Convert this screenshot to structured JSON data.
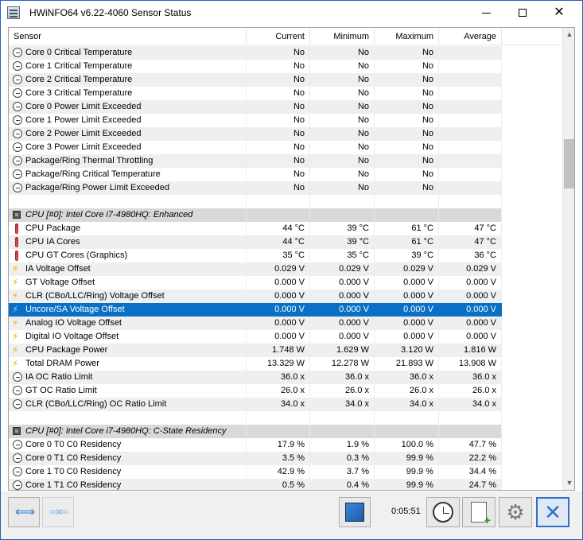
{
  "window": {
    "title": "HWiNFO64 v6.22-4060 Sensor Status"
  },
  "columns": [
    "Sensor",
    "Current",
    "Minimum",
    "Maximum",
    "Average"
  ],
  "rows": [
    {
      "kind": "clock",
      "alt": true,
      "name": "Core 0 Critical Temperature",
      "cur": "No",
      "min": "No",
      "max": "No",
      "avg": ""
    },
    {
      "kind": "clock",
      "alt": false,
      "name": "Core 1 Critical Temperature",
      "cur": "No",
      "min": "No",
      "max": "No",
      "avg": ""
    },
    {
      "kind": "clock",
      "alt": true,
      "name": "Core 2 Critical Temperature",
      "cur": "No",
      "min": "No",
      "max": "No",
      "avg": ""
    },
    {
      "kind": "clock",
      "alt": false,
      "name": "Core 3 Critical Temperature",
      "cur": "No",
      "min": "No",
      "max": "No",
      "avg": ""
    },
    {
      "kind": "clock",
      "alt": true,
      "name": "Core 0 Power Limit Exceeded",
      "cur": "No",
      "min": "No",
      "max": "No",
      "avg": ""
    },
    {
      "kind": "clock",
      "alt": false,
      "name": "Core 1 Power Limit Exceeded",
      "cur": "No",
      "min": "No",
      "max": "No",
      "avg": ""
    },
    {
      "kind": "clock",
      "alt": true,
      "name": "Core 2 Power Limit Exceeded",
      "cur": "No",
      "min": "No",
      "max": "No",
      "avg": ""
    },
    {
      "kind": "clock",
      "alt": false,
      "name": "Core 3 Power Limit Exceeded",
      "cur": "No",
      "min": "No",
      "max": "No",
      "avg": ""
    },
    {
      "kind": "clock",
      "alt": true,
      "name": "Package/Ring Thermal Throttling",
      "cur": "No",
      "min": "No",
      "max": "No",
      "avg": ""
    },
    {
      "kind": "clock",
      "alt": false,
      "name": "Package/Ring Critical Temperature",
      "cur": "No",
      "min": "No",
      "max": "No",
      "avg": ""
    },
    {
      "kind": "clock",
      "alt": true,
      "name": "Package/Ring Power Limit Exceeded",
      "cur": "No",
      "min": "No",
      "max": "No",
      "avg": ""
    },
    {
      "kind": "blank",
      "alt": false,
      "name": "",
      "cur": "",
      "min": "",
      "max": "",
      "avg": ""
    },
    {
      "kind": "group",
      "alt": false,
      "name": "CPU [#0]: Intel Core i7-4980HQ: Enhanced",
      "cur": "",
      "min": "",
      "max": "",
      "avg": ""
    },
    {
      "kind": "therm",
      "alt": false,
      "name": "CPU Package",
      "cur": "44 °C",
      "min": "39 °C",
      "max": "61 °C",
      "avg": "47 °C"
    },
    {
      "kind": "therm",
      "alt": true,
      "name": "CPU IA Cores",
      "cur": "44 °C",
      "min": "39 °C",
      "max": "61 °C",
      "avg": "47 °C"
    },
    {
      "kind": "therm",
      "alt": false,
      "name": "CPU GT Cores (Graphics)",
      "cur": "35 °C",
      "min": "35 °C",
      "max": "39 °C",
      "avg": "36 °C"
    },
    {
      "kind": "bolt",
      "alt": true,
      "name": "IA Voltage Offset",
      "cur": "0.029 V",
      "min": "0.029 V",
      "max": "0.029 V",
      "avg": "0.029 V"
    },
    {
      "kind": "bolt",
      "alt": false,
      "name": "GT Voltage Offset",
      "cur": "0.000 V",
      "min": "0.000 V",
      "max": "0.000 V",
      "avg": "0.000 V"
    },
    {
      "kind": "bolt",
      "alt": true,
      "name": "CLR (CBo/LLC/Ring) Voltage Offset",
      "cur": "0.000 V",
      "min": "0.000 V",
      "max": "0.000 V",
      "avg": "0.000 V"
    },
    {
      "kind": "bolt",
      "alt": false,
      "sel": true,
      "name": "Uncore/SA Voltage Offset",
      "cur": "0.000 V",
      "min": "0.000 V",
      "max": "0.000 V",
      "avg": "0.000 V"
    },
    {
      "kind": "bolt",
      "alt": true,
      "name": "Analog IO Voltage Offset",
      "cur": "0.000 V",
      "min": "0.000 V",
      "max": "0.000 V",
      "avg": "0.000 V"
    },
    {
      "kind": "bolt",
      "alt": false,
      "name": "Digital IO Voltage Offset",
      "cur": "0.000 V",
      "min": "0.000 V",
      "max": "0.000 V",
      "avg": "0.000 V"
    },
    {
      "kind": "bolt",
      "alt": true,
      "name": "CPU Package Power",
      "cur": "1.748 W",
      "min": "1.629 W",
      "max": "3.120 W",
      "avg": "1.816 W"
    },
    {
      "kind": "bolt",
      "alt": false,
      "name": "Total DRAM Power",
      "cur": "13.329 W",
      "min": "12.278 W",
      "max": "21.893 W",
      "avg": "13.908 W"
    },
    {
      "kind": "clock",
      "alt": true,
      "name": "IA OC Ratio Limit",
      "cur": "36.0 x",
      "min": "36.0 x",
      "max": "36.0 x",
      "avg": "36.0 x"
    },
    {
      "kind": "clock",
      "alt": false,
      "name": "GT OC Ratio Limit",
      "cur": "26.0 x",
      "min": "26.0 x",
      "max": "26.0 x",
      "avg": "26.0 x"
    },
    {
      "kind": "clock",
      "alt": true,
      "name": "CLR (CBo/LLC/Ring) OC Ratio Limit",
      "cur": "34.0 x",
      "min": "34.0 x",
      "max": "34.0 x",
      "avg": "34.0 x"
    },
    {
      "kind": "blank",
      "alt": false,
      "name": "",
      "cur": "",
      "min": "",
      "max": "",
      "avg": ""
    },
    {
      "kind": "group",
      "alt": false,
      "name": "CPU [#0]: Intel Core i7-4980HQ: C-State Residency",
      "cur": "",
      "min": "",
      "max": "",
      "avg": ""
    },
    {
      "kind": "clock",
      "alt": false,
      "name": "Core 0 T0 C0 Residency",
      "cur": "17.9 %",
      "min": "1.9 %",
      "max": "100.0 %",
      "avg": "47.7 %"
    },
    {
      "kind": "clock",
      "alt": true,
      "name": "Core 0 T1 C0 Residency",
      "cur": "3.5 %",
      "min": "0.3 %",
      "max": "99.9 %",
      "avg": "22.2 %"
    },
    {
      "kind": "clock",
      "alt": false,
      "name": "Core 1 T0 C0 Residency",
      "cur": "42.9 %",
      "min": "3.7 %",
      "max": "99.9 %",
      "avg": "34.4 %"
    },
    {
      "kind": "clock",
      "alt": true,
      "name": "Core 1 T1 C0 Residency",
      "cur": "0.5 %",
      "min": "0.4 %",
      "max": "99.9 %",
      "avg": "24.7 %"
    }
  ],
  "toolbar": {
    "elapsed": "0:05:51"
  },
  "icons": {
    "nav_back_forward": "double-arrow-icon",
    "network": "network-icon",
    "clock": "clock-icon",
    "report": "report-add-icon",
    "settings": "gear-icon",
    "close": "close-icon"
  }
}
